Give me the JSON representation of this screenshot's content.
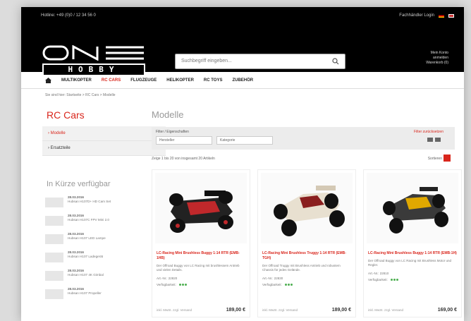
{
  "topbar": {
    "left_text": "Hotline: +49 (0)0 / 12 34 56 0",
    "right_text": "Fachhändler Login"
  },
  "search": {
    "placeholder": "Suchbegriff eingeben..."
  },
  "account": {
    "line1": "Mein Konto",
    "line2": "anmelden",
    "line3": "Warenkorb (0)"
  },
  "nav": {
    "items": [
      {
        "label": "MULTIKOPTER"
      },
      {
        "label": "RC CARS",
        "active": true
      },
      {
        "label": "FLUGZEUGE"
      },
      {
        "label": "HELIKOPTER"
      },
      {
        "label": "RC TOYS"
      },
      {
        "label": "ZUBEHÖR"
      }
    ]
  },
  "breadcrumb": "Sie sind hier: Startseite > RC Cars > Modelle",
  "sidebar": {
    "title": "RC Cars",
    "menu": [
      {
        "label": "› Modelle",
        "active": true
      },
      {
        "label": "› Ersatzteile"
      }
    ],
    "soon_title": "In Kürze verfügbar",
    "soon_items": [
      {
        "date": "28.03.2016",
        "text": "Hubsan H107D+ HD Cam Set"
      },
      {
        "date": "28.03.2016",
        "text": "Hubsan H107C FPV Mini 2.0"
      },
      {
        "date": "28.03.2016",
        "text": "Hubsan H107 LED Lampe"
      },
      {
        "date": "28.03.2016",
        "text": "Hubsan H107 Ladegerät"
      },
      {
        "date": "28.03.2016",
        "text": "Hubsan H107 4K Gimbal"
      },
      {
        "date": "28.03.2016",
        "text": "Hubsan H107 Propeller"
      }
    ]
  },
  "main": {
    "title": "Modelle",
    "filter_label": "Filter / Eigenschaften",
    "select1": "Hersteller",
    "select2": "Kategorie",
    "reset_link": "Filter zurücksetzen",
    "result_text": "Zeige 1 bis 20 von insgesamt 20 Artikeln",
    "sort_label": "Sortieren"
  },
  "products": [
    {
      "name": "LC-Racing Mini Brushless Buggy 1:14 RTR (EMB-1HB)",
      "desc": "Der Offroad Buggy von LC Racing mit brushlessem Antrieb und vielen Details.",
      "artnr": "Art.-Nr.: 22820",
      "avail": "Verfügbarkeit:",
      "price_note": "inkl. MwSt. zzgl. Versand",
      "price": "189,00 €"
    },
    {
      "name": "LC-Racing Mini Brushless Truggy 1:14 RTR (EMB-TGH)",
      "desc": "Der Offroad Truggy mit Brushless Antrieb und robustem Chassis für jedes Gelände.",
      "artnr": "Art.-Nr.: 22830",
      "avail": "Verfügbarkeit:",
      "price_note": "inkl. MwSt. zzgl. Versand",
      "price": "189,00 €"
    },
    {
      "name": "LC-Racing Mini Brushless Buggy 1:14 RTR (EMB-1H)",
      "desc": "Der Offroad Buggy von LC Racing mit Brushless Motor und Regler.",
      "artnr": "Art.-Nr.: 22810",
      "avail": "Verfügbarkeit:",
      "price_note": "inkl. MwSt. zzgl. Versand",
      "price": "169,00 €"
    }
  ],
  "colors": {
    "accent": "#d9261c",
    "header": "#000000",
    "in_stock": "#4caf50"
  }
}
